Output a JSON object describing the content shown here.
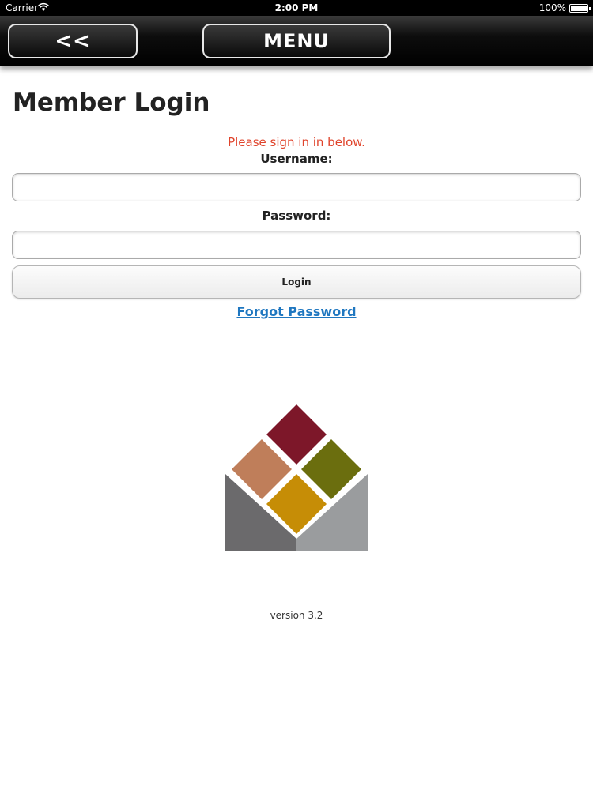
{
  "status_bar": {
    "carrier": "Carrier",
    "time": "2:00 PM",
    "battery": "100%"
  },
  "navbar": {
    "back_label": "<<",
    "menu_label": "MENU"
  },
  "login": {
    "title": "Member Login",
    "notice": "Please sign in in below.",
    "username_label": "Username:",
    "username_value": "",
    "password_label": "Password:",
    "password_value": "",
    "login_button": "Login",
    "forgot_link": "Forgot Password"
  },
  "logo": {
    "colors": {
      "top": "#7d1729",
      "left": "#bf7e5a",
      "right": "#6b6e0e",
      "center": "#c68d06",
      "base_left": "#6b6a6c",
      "base_right": "#9a9c9e"
    }
  },
  "footer": {
    "version": "version 3.2"
  }
}
